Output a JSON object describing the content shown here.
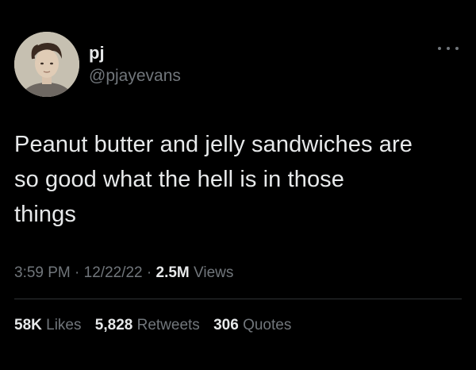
{
  "tweet": {
    "author": {
      "display_name": "pj",
      "handle": "@pjayevans",
      "avatar_icon": "profile-photo"
    },
    "more_icon": "more-options-icon",
    "text_lines": [
      "Peanut butter and jelly sandwiches are",
      "so good what the hell is in those",
      "things"
    ],
    "meta": {
      "time": "3:59 PM",
      "separator": "·",
      "date": "12/22/22",
      "views_count": "2.5M",
      "views_label": "Views"
    },
    "stats": {
      "likes_count": "58K",
      "likes_label": "Likes",
      "retweets_count": "5,828",
      "retweets_label": "Retweets",
      "quotes_count": "306",
      "quotes_label": "Quotes"
    },
    "colors": {
      "background": "#000000",
      "primary_text": "#e7e9ea",
      "secondary_text": "#71767b",
      "divider": "#2f3336"
    }
  }
}
